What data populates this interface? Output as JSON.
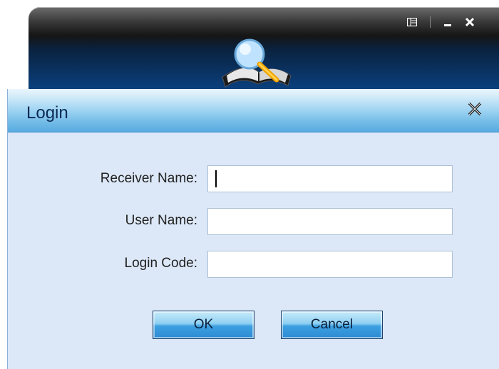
{
  "app_window": {
    "icons": {
      "menu": "list-menu-icon",
      "minimize": "minimize-icon",
      "close": "close-icon",
      "logo": "search-notebook-logo"
    }
  },
  "dialog": {
    "title": "Login",
    "close_icon": "close-icon",
    "fields": [
      {
        "label": "Receiver Name:",
        "value": ""
      },
      {
        "label": "User Name:",
        "value": ""
      },
      {
        "label": "Login Code:",
        "value": ""
      }
    ],
    "buttons": {
      "ok": "OK",
      "cancel": "Cancel"
    }
  },
  "colors": {
    "dialog_bg": "#dce8f8",
    "title_text": "#0b2a55",
    "button_blue": "#3c9fe0"
  }
}
